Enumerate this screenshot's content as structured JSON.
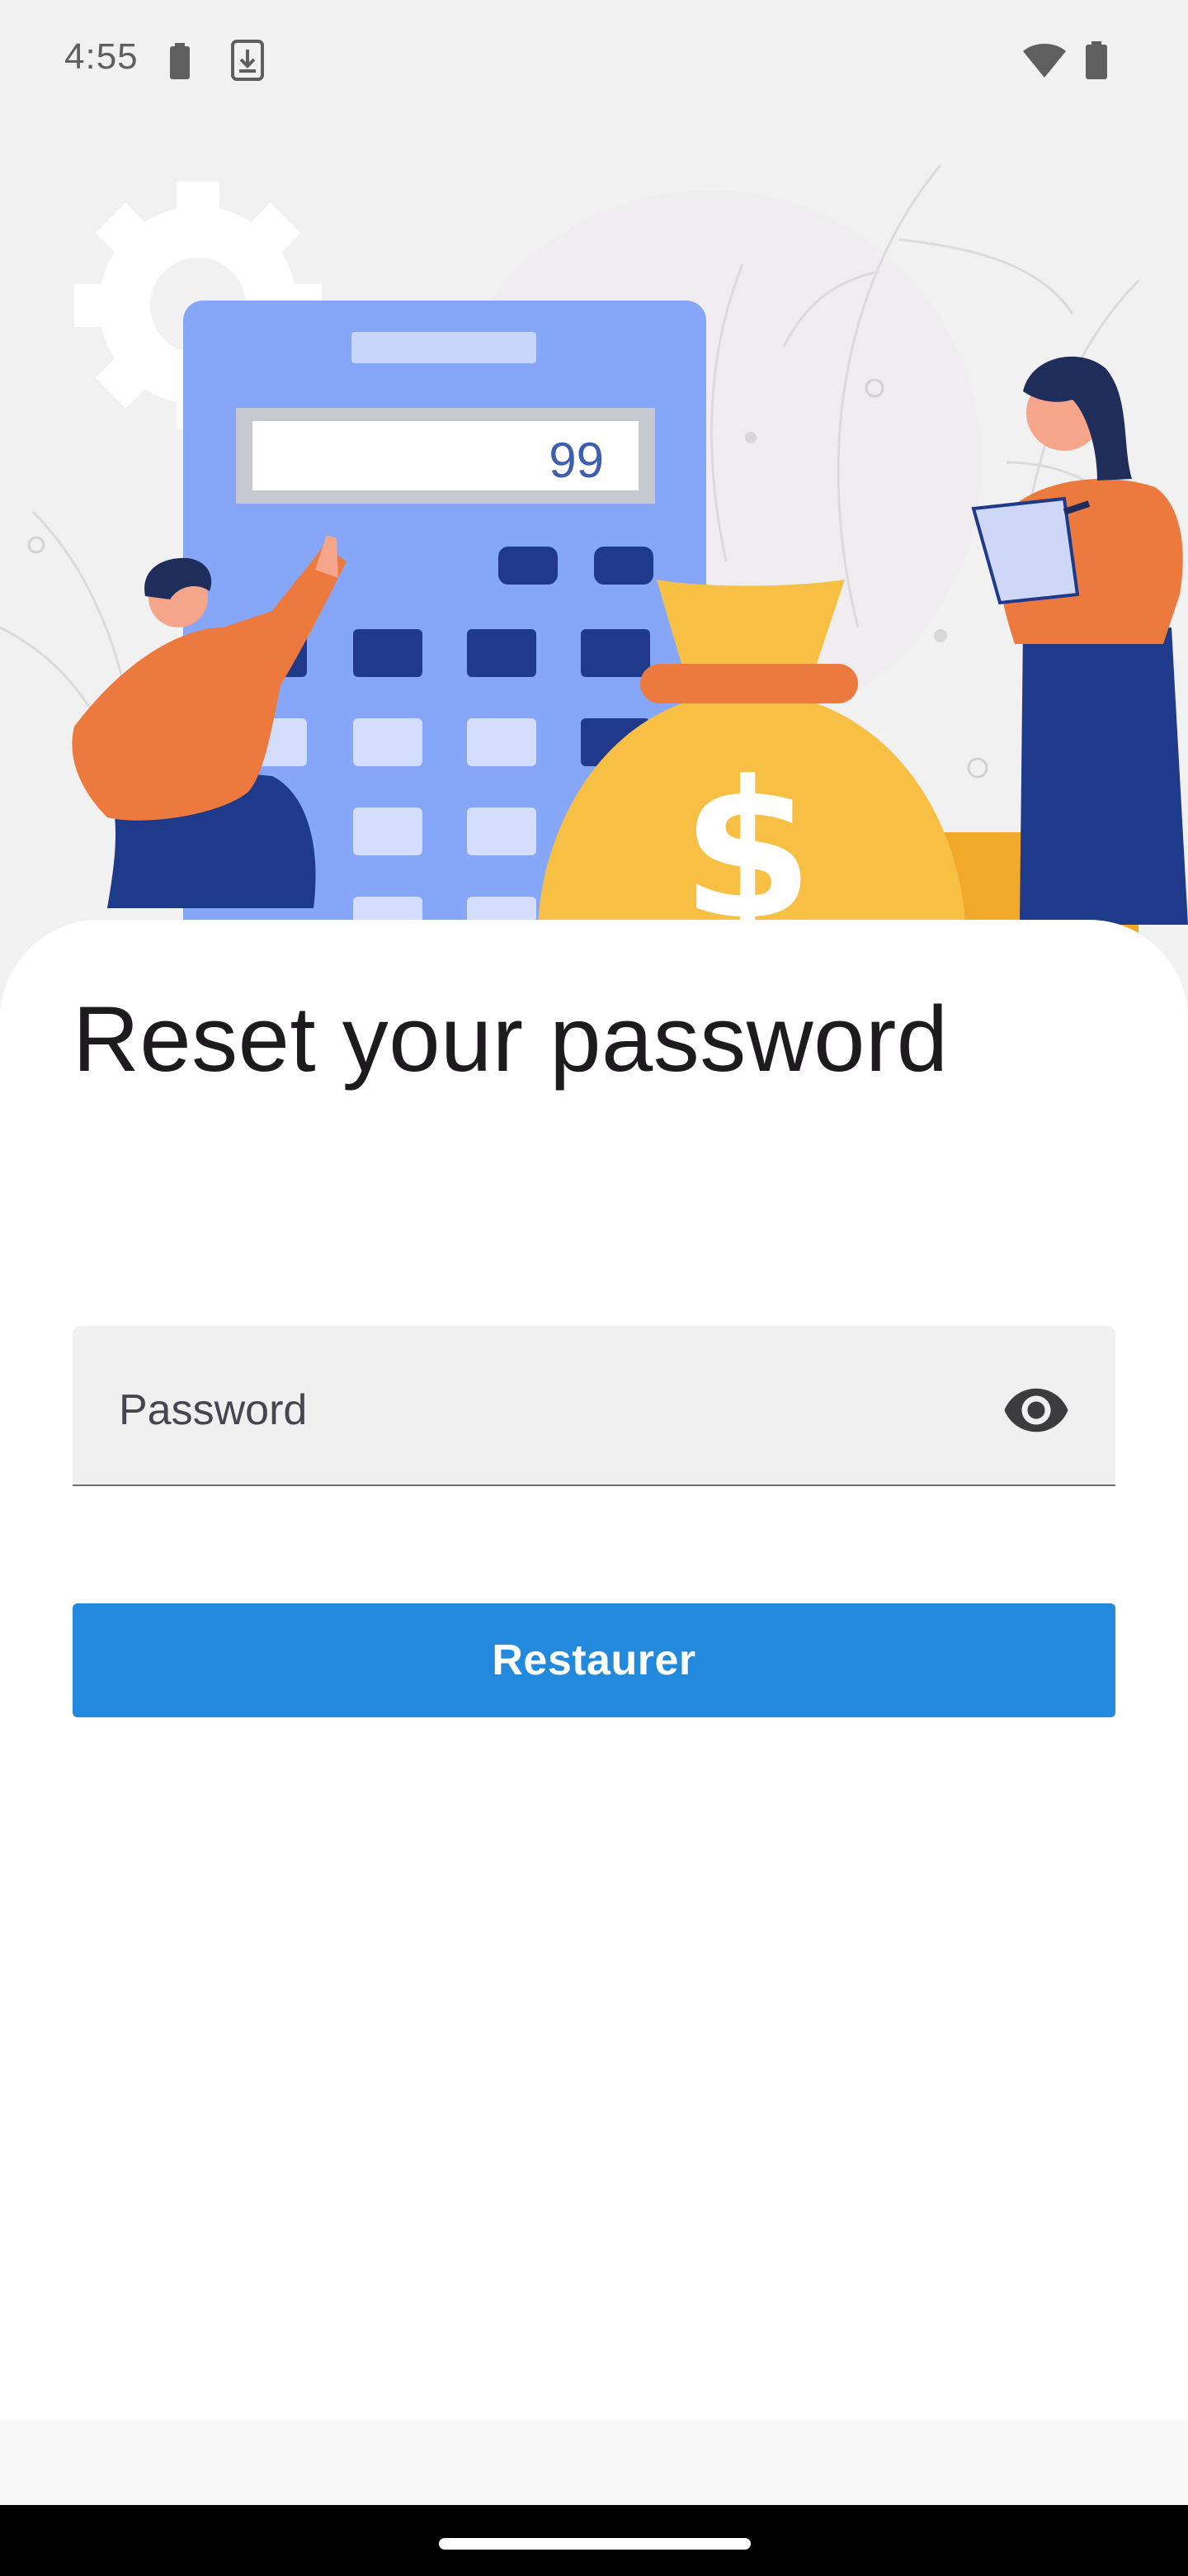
{
  "status_bar": {
    "time": "4:55",
    "icons": [
      "battery-small-icon",
      "download-icon",
      "wifi-icon",
      "battery-icon"
    ]
  },
  "illustration": {
    "calculator_display": "99"
  },
  "reset": {
    "title": "Reset your password",
    "password_placeholder": "Password",
    "password_value": "",
    "visibility_icon": "eye-icon",
    "submit_label": "Restaurer"
  },
  "colors": {
    "accent": "#2389dd",
    "title_text": "#1d1b1e",
    "field_bg": "#f1f0f1",
    "calculator": "#86a6f8",
    "person_shirt": "#ec7a3f",
    "money_bag": "#f7c044"
  }
}
